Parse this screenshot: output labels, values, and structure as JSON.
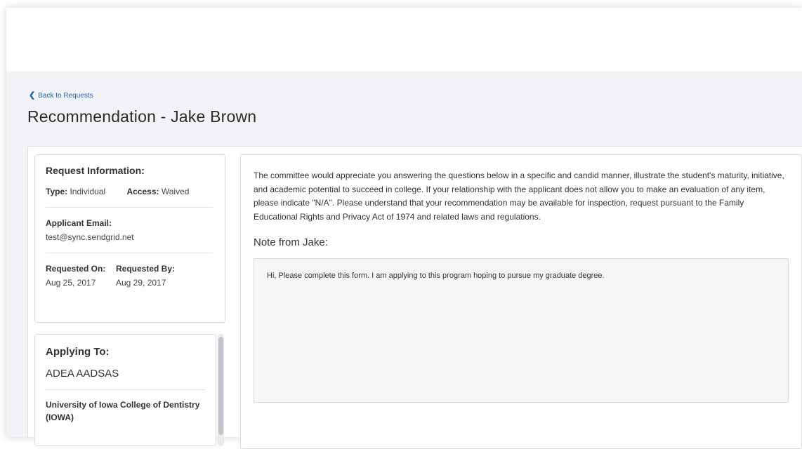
{
  "header": {
    "back_label": "Back to Requests",
    "title": "Recommendation - Jake Brown"
  },
  "request_info": {
    "heading": "Request Information:",
    "type_label": "Type:",
    "type_value": "Individual",
    "access_label": "Access:",
    "access_value": "Waived",
    "email_label": "Applicant Email:",
    "email_value": "test@sync.sendgrid.net",
    "requested_on_label": "Requested On:",
    "requested_on_value": "Aug 25, 2017",
    "requested_by_label": "Requested By:",
    "requested_by_value": "Aug 29, 2017"
  },
  "applying_to": {
    "heading": "Applying To:",
    "program": "ADEA AADSAS",
    "school": "University of Iowa College of Dentistry (IOWA)"
  },
  "content": {
    "intro": "The committee would appreciate you answering the questions below in a specific and candid manner, illustrate the student's maturity, initiative, and academic potential to succeed in college. If your relationship with the applicant does not allow you to make an evaluation of any item, please indicate \"N/A\". Please understand that your recommendation may be available for inspection, request pursuant to the Family Educational Rights and Privacy Act of 1974 and related laws and regulations.",
    "note_label": "Note from Jake:",
    "note_text": "Hi, Please complete this form. I am applying to this program hoping to pursue my graduate degree."
  },
  "colors": {
    "accent_link": "#2a63b3",
    "page_bg": "#f2f3f6"
  }
}
